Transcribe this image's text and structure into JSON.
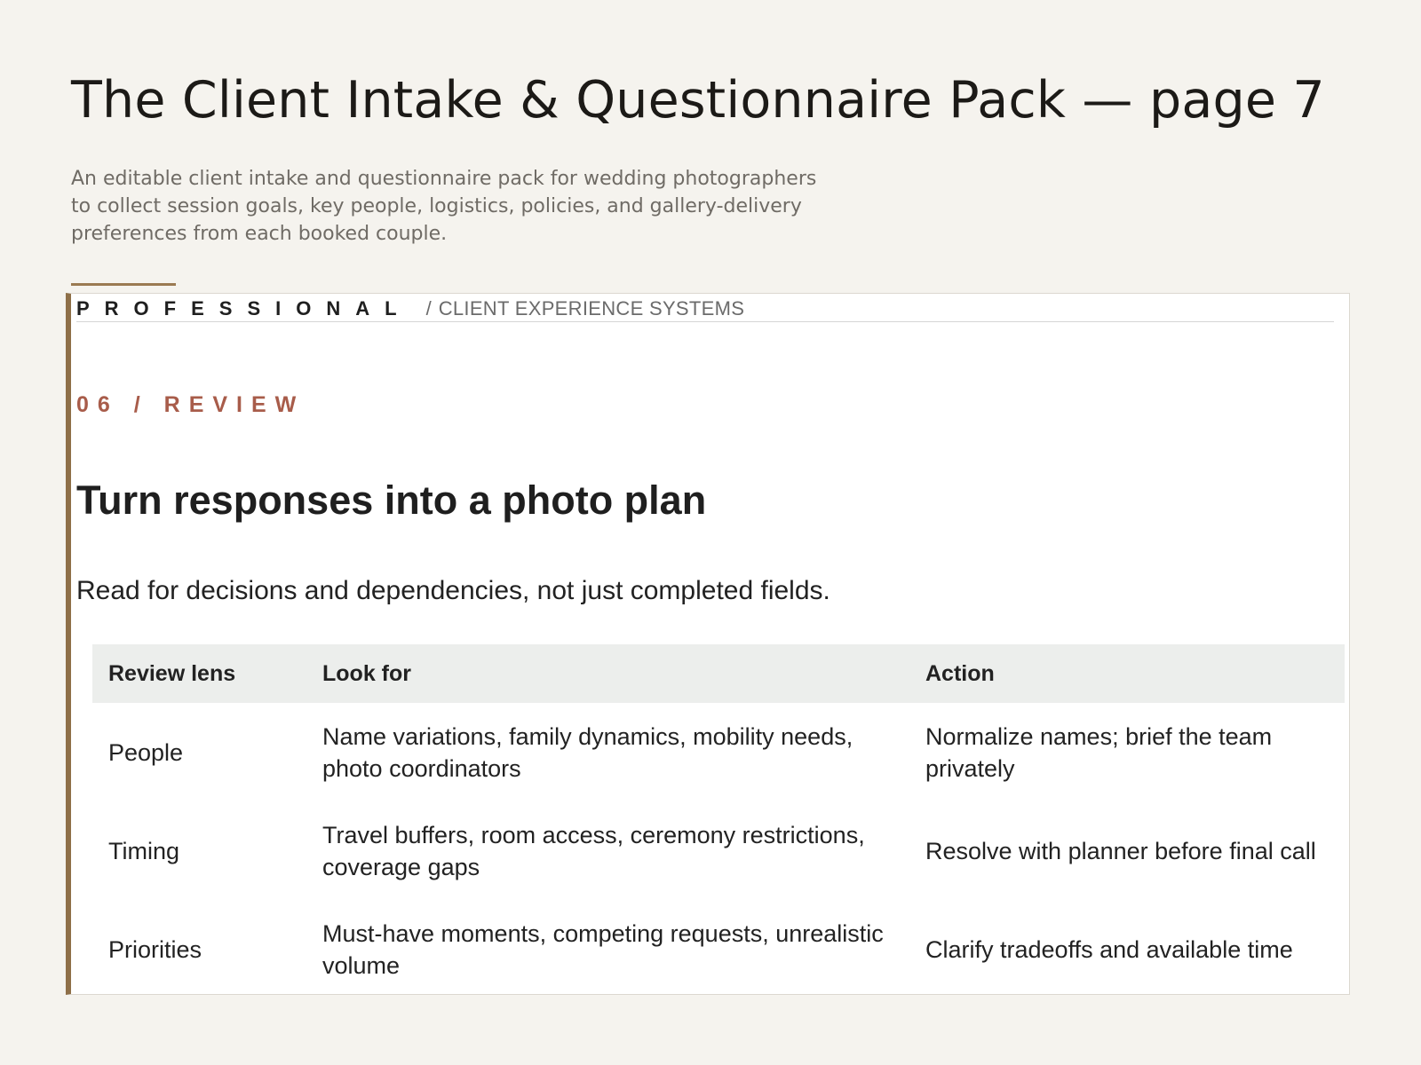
{
  "document": {
    "title": "The Client Intake & Questionnaire Pack — page 7",
    "description": "An editable client intake and questionnaire pack for wedding photographers to collect session goals, key people, logistics, policies, and gallery-delivery preferences from each booked couple."
  },
  "sheet": {
    "brand": "PROFESSIONAL",
    "breadcrumb_separator": "/",
    "breadcrumb": "CLIENT EXPERIENCE SYSTEMS",
    "kicker": "06 / REVIEW",
    "heading": "Turn responses into a photo plan",
    "lede": "Read for decisions and dependencies, not just completed fields."
  },
  "table": {
    "headers": [
      "Review lens",
      "Look for",
      "Action"
    ],
    "rows": [
      [
        "People",
        "Name variations, family dynamics, mobility needs, photo coordinators",
        "Normalize names; brief the team privately"
      ],
      [
        "Timing",
        "Travel buffers, room access, ceremony restrictions, coverage gaps",
        "Resolve with planner before final call"
      ],
      [
        "Priorities",
        "Must-have moments, competing requests, unrealistic volume",
        "Clarify tradeoffs and available time"
      ]
    ]
  },
  "colors": {
    "page_background": "#f5f3ee",
    "accent_gold": "#9a7a52",
    "sheet_border_accent": "#8e6f48",
    "kicker": "#a85c4a",
    "table_header_bg": "#eceeec"
  }
}
